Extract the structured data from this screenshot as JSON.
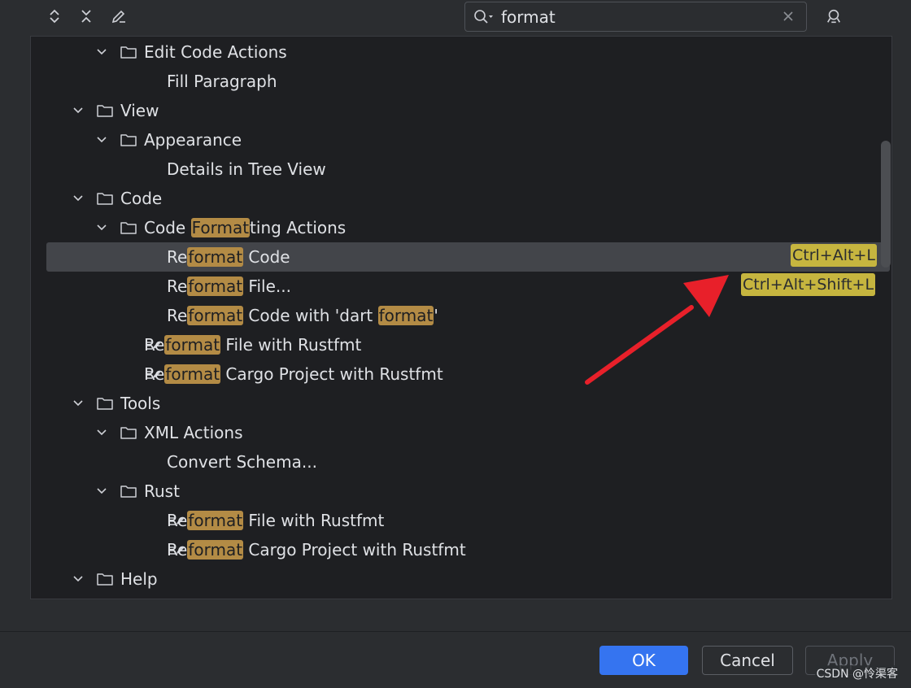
{
  "toolbar": {
    "expand_all_icon": "expand-all-icon",
    "collapse_all_icon": "collapse-all-icon",
    "edit_icon": "pencil-icon",
    "find_shortcut_icon": "find-by-shortcut-icon"
  },
  "search": {
    "value": "format",
    "icon": "search-icon",
    "clear_icon": "close-icon"
  },
  "tree": {
    "rows": [
      {
        "segs": [
          "Edit Code Actions"
        ]
      },
      {
        "segs": [
          "Fill Paragraph"
        ]
      },
      {
        "segs": [
          "View"
        ]
      },
      {
        "segs": [
          "Appearance"
        ]
      },
      {
        "segs": [
          "Details in Tree View"
        ]
      },
      {
        "segs": [
          "Code"
        ]
      },
      {
        "segs": [
          "Code ",
          "Format",
          "ting Actions"
        ]
      },
      {
        "segs": [
          "Re",
          "format",
          " Code"
        ],
        "shortcut": "Ctrl+Alt+L"
      },
      {
        "segs": [
          "Re",
          "format",
          " File..."
        ],
        "shortcut": "Ctrl+Alt+Shift+L"
      },
      {
        "segs": [
          "Re",
          "format",
          " Code with 'dart ",
          "format",
          "'"
        ]
      },
      {
        "segs": [
          "Re",
          "format",
          " File with Rustfmt"
        ]
      },
      {
        "segs": [
          "Re",
          "format",
          " Cargo Project with Rustfmt"
        ]
      },
      {
        "segs": [
          "Tools"
        ]
      },
      {
        "segs": [
          "XML Actions"
        ]
      },
      {
        "segs": [
          "Convert Schema..."
        ]
      },
      {
        "segs": [
          "Rust"
        ]
      },
      {
        "segs": [
          "Re",
          "format",
          " File with Rustfmt"
        ]
      },
      {
        "segs": [
          "Re",
          "format",
          " Cargo Project with Rustfmt"
        ]
      },
      {
        "segs": [
          "Help"
        ]
      }
    ]
  },
  "buttons": {
    "ok": "OK",
    "cancel": "Cancel",
    "apply": "Apply"
  },
  "watermark": "CSDN @怜渠客",
  "colors": {
    "highlight": "#b38b45",
    "shortcut_badge": "#c6b53f",
    "accent": "#3574f0",
    "annotation_arrow": "#e8202a"
  }
}
